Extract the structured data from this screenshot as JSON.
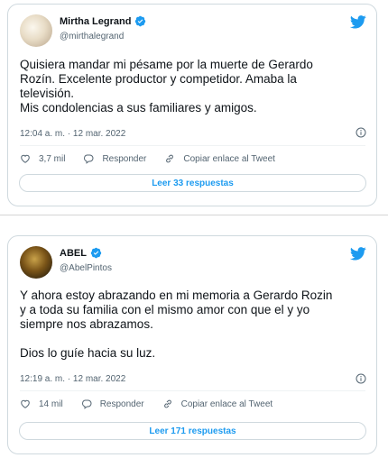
{
  "tweets": [
    {
      "author": "Mirtha Legrand",
      "handle": "@mirthalegrand",
      "text_lines": [
        "Quisiera mandar mi pésame por la muerte de Gerardo",
        "Rozín. Excelente productor y competidor. Amaba la",
        "televisión.",
        "Mis condolencias a sus familiares y amigos."
      ],
      "timestamp": "12:04 a. m. · 12 mar. 2022",
      "likes": "3,7 mil",
      "reply_label": "Responder",
      "copy_link_label": "Copiar enlace al Tweet",
      "read_replies_label": "Leer 33 respuestas"
    },
    {
      "author": "ABEL",
      "handle": "@AbelPintos",
      "text_lines": [
        "Y ahora estoy abrazando en mi memoria a Gerardo Rozin",
        "y a toda su familia con el mismo amor con que el y yo",
        "siempre nos abrazamos.",
        "",
        "Dios lo guíe hacia su luz."
      ],
      "timestamp": "12:19 a. m. · 12 mar. 2022",
      "likes": "14 mil",
      "reply_label": "Responder",
      "copy_link_label": "Copiar enlace al Tweet",
      "read_replies_label": "Leer 171 respuestas"
    }
  ],
  "colors": {
    "twitter_blue": "#1d9bf0",
    "text_primary": "#0f1419",
    "text_secondary": "#536471",
    "border": "#cfd9de"
  },
  "icons": [
    "verified-badge-icon",
    "twitter-bird-icon",
    "info-icon",
    "heart-icon",
    "reply-icon",
    "link-icon"
  ]
}
